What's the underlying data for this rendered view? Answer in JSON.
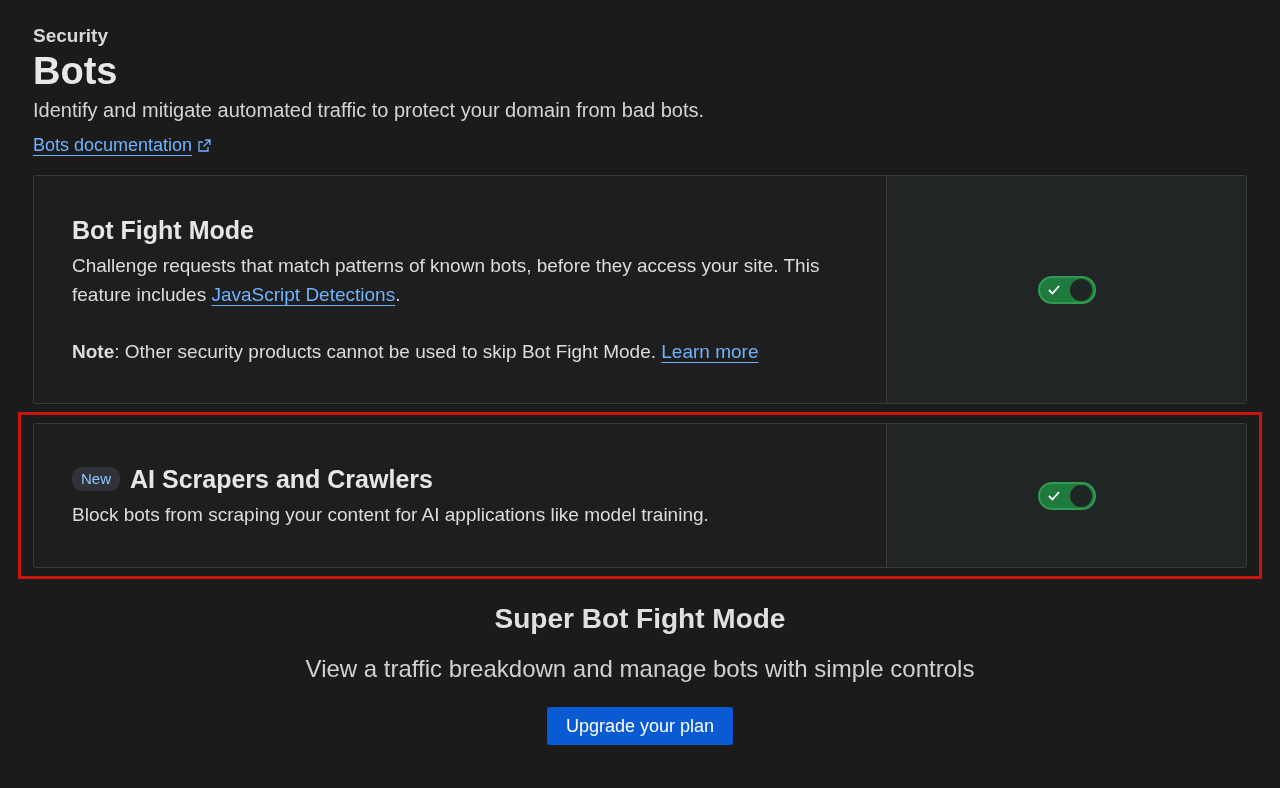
{
  "header": {
    "section": "Security",
    "title": "Bots",
    "description": "Identify and mitigate automated traffic to protect your domain from bad bots.",
    "doc_link": "Bots documentation"
  },
  "cards": [
    {
      "title": "Bot Fight Mode",
      "highlighted": false,
      "on": true,
      "paragraphs": [
        [
          {
            "kind": "text",
            "text": "Challenge requests that match patterns of known bots, before they access your site. This feature includes "
          },
          {
            "kind": "link",
            "text": "JavaScript Detections"
          },
          {
            "kind": "text",
            "text": "."
          }
        ],
        [
          {
            "kind": "text",
            "text": "**Note**: Other security products cannot be used to skip Bot Fight Mode. "
          },
          {
            "kind": "link",
            "text": "Learn more"
          }
        ]
      ]
    },
    {
      "title": "AI Scrapers and Crawlers",
      "badge": "New",
      "highlighted": true,
      "on": true,
      "paragraphs": [
        [
          {
            "kind": "text",
            "text": "Block bots from scraping your content for AI applications like model training."
          }
        ]
      ]
    }
  ],
  "upsell": {
    "title": "Super Bot Fight Mode",
    "subtitle": "View a traffic breakdown and manage bots with simple controls",
    "button": "Upgrade your plan"
  }
}
